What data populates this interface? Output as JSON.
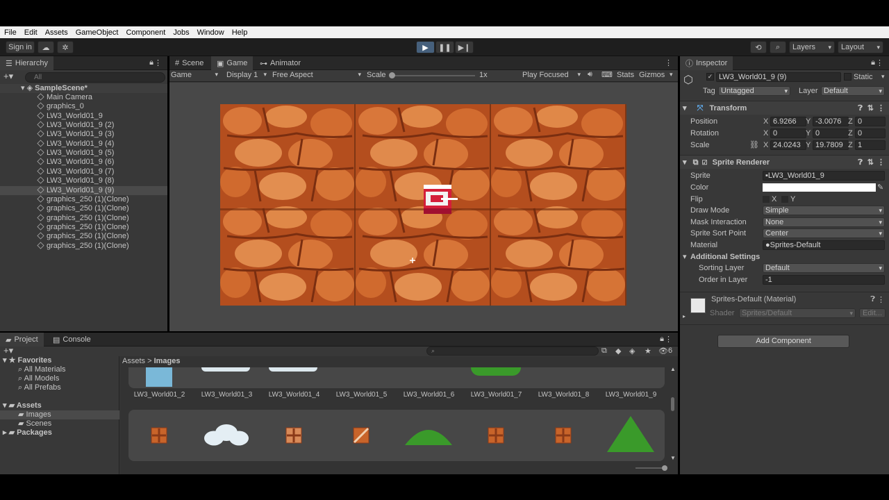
{
  "menu": [
    "File",
    "Edit",
    "Assets",
    "GameObject",
    "Component",
    "Jobs",
    "Window",
    "Help"
  ],
  "toolbar": {
    "sign_in": "Sign in",
    "layers": "Layers",
    "layout": "Layout"
  },
  "hierarchy": {
    "tab": "Hierarchy",
    "search_placeholder": "All",
    "scene": "SampleScene*",
    "items": [
      "Main Camera",
      "graphics_0",
      "LW3_World01_9",
      "LW3_World01_9 (2)",
      "LW3_World01_9 (3)",
      "LW3_World01_9 (4)",
      "LW3_World01_9 (5)",
      "LW3_World01_9 (6)",
      "LW3_World01_9 (7)",
      "LW3_World01_9 (8)",
      "LW3_World01_9 (9)",
      "graphics_250 (1)(Clone)",
      "graphics_250 (1)(Clone)",
      "graphics_250 (1)(Clone)",
      "graphics_250 (1)(Clone)",
      "graphics_250 (1)(Clone)",
      "graphics_250 (1)(Clone)"
    ],
    "selected_index": 10
  },
  "game": {
    "tabs": [
      "Scene",
      "Game",
      "Animator"
    ],
    "selected_tab": 1,
    "display_mode": "Game",
    "display": "Display 1",
    "aspect": "Free Aspect",
    "scale_label": "Scale",
    "scale_value": "1x",
    "play_focused": "Play Focused",
    "stats": "Stats",
    "gizmos": "Gizmos"
  },
  "inspector": {
    "tab": "Inspector",
    "object_name": "LW3_World01_9 (9)",
    "static_label": "Static",
    "tag_label": "Tag",
    "tag_value": "Untagged",
    "layer_label": "Layer",
    "layer_value": "Default",
    "transform": {
      "title": "Transform",
      "position_label": "Position",
      "rotation_label": "Rotation",
      "scale_label": "Scale",
      "position": [
        "6.9266",
        "-3.0076",
        "0"
      ],
      "rotation": [
        "0",
        "0",
        "0"
      ],
      "scale": [
        "24.0243",
        "19.7809",
        "1"
      ]
    },
    "sprite_renderer": {
      "title": "Sprite Renderer",
      "sprite_label": "Sprite",
      "sprite_value": "LW3_World01_9",
      "color_label": "Color",
      "flip_label": "Flip",
      "flip_x": "X",
      "flip_y": "Y",
      "draw_mode_label": "Draw Mode",
      "draw_mode_value": "Simple",
      "mask_label": "Mask Interaction",
      "mask_value": "None",
      "sort_point_label": "Sprite Sort Point",
      "sort_point_value": "Center",
      "material_label": "Material",
      "material_value": "Sprites-Default",
      "additional_label": "Additional Settings",
      "sorting_layer_label": "Sorting Layer",
      "sorting_layer_value": "Default",
      "order_label": "Order in Layer",
      "order_value": "-1"
    },
    "material": {
      "title": "Sprites-Default (Material)",
      "shader_label": "Shader",
      "shader_value": "Sprites/Default",
      "edit": "Edit..."
    },
    "add_component": "Add Component"
  },
  "project": {
    "tabs": [
      "Project",
      "Console"
    ],
    "favorites": "Favorites",
    "fav_items": [
      "All Materials",
      "All Models",
      "All Prefabs"
    ],
    "assets": "Assets",
    "asset_items": [
      "Images",
      "Scenes"
    ],
    "packages": "Packages",
    "breadcrumb": [
      "Assets",
      "Images"
    ],
    "hidden_count": "6",
    "row1_labels": [
      "LW3_World01_2",
      "LW3_World01_3",
      "LW3_World01_4",
      "LW3_World01_5",
      "LW3_World01_6",
      "LW3_World01_7",
      "LW3_World01_8",
      "LW3_World01_9"
    ],
    "row2_kinds": [
      "brick",
      "cloud",
      "brick-light",
      "brick-stripe",
      "bush",
      "brick",
      "brick",
      "tree"
    ]
  },
  "colors": {
    "brick": "#c8642a",
    "brick_dark": "#8a3a18",
    "bush": "#3a9a2a",
    "cloud": "#e4eef4",
    "accent": "#46607c"
  }
}
